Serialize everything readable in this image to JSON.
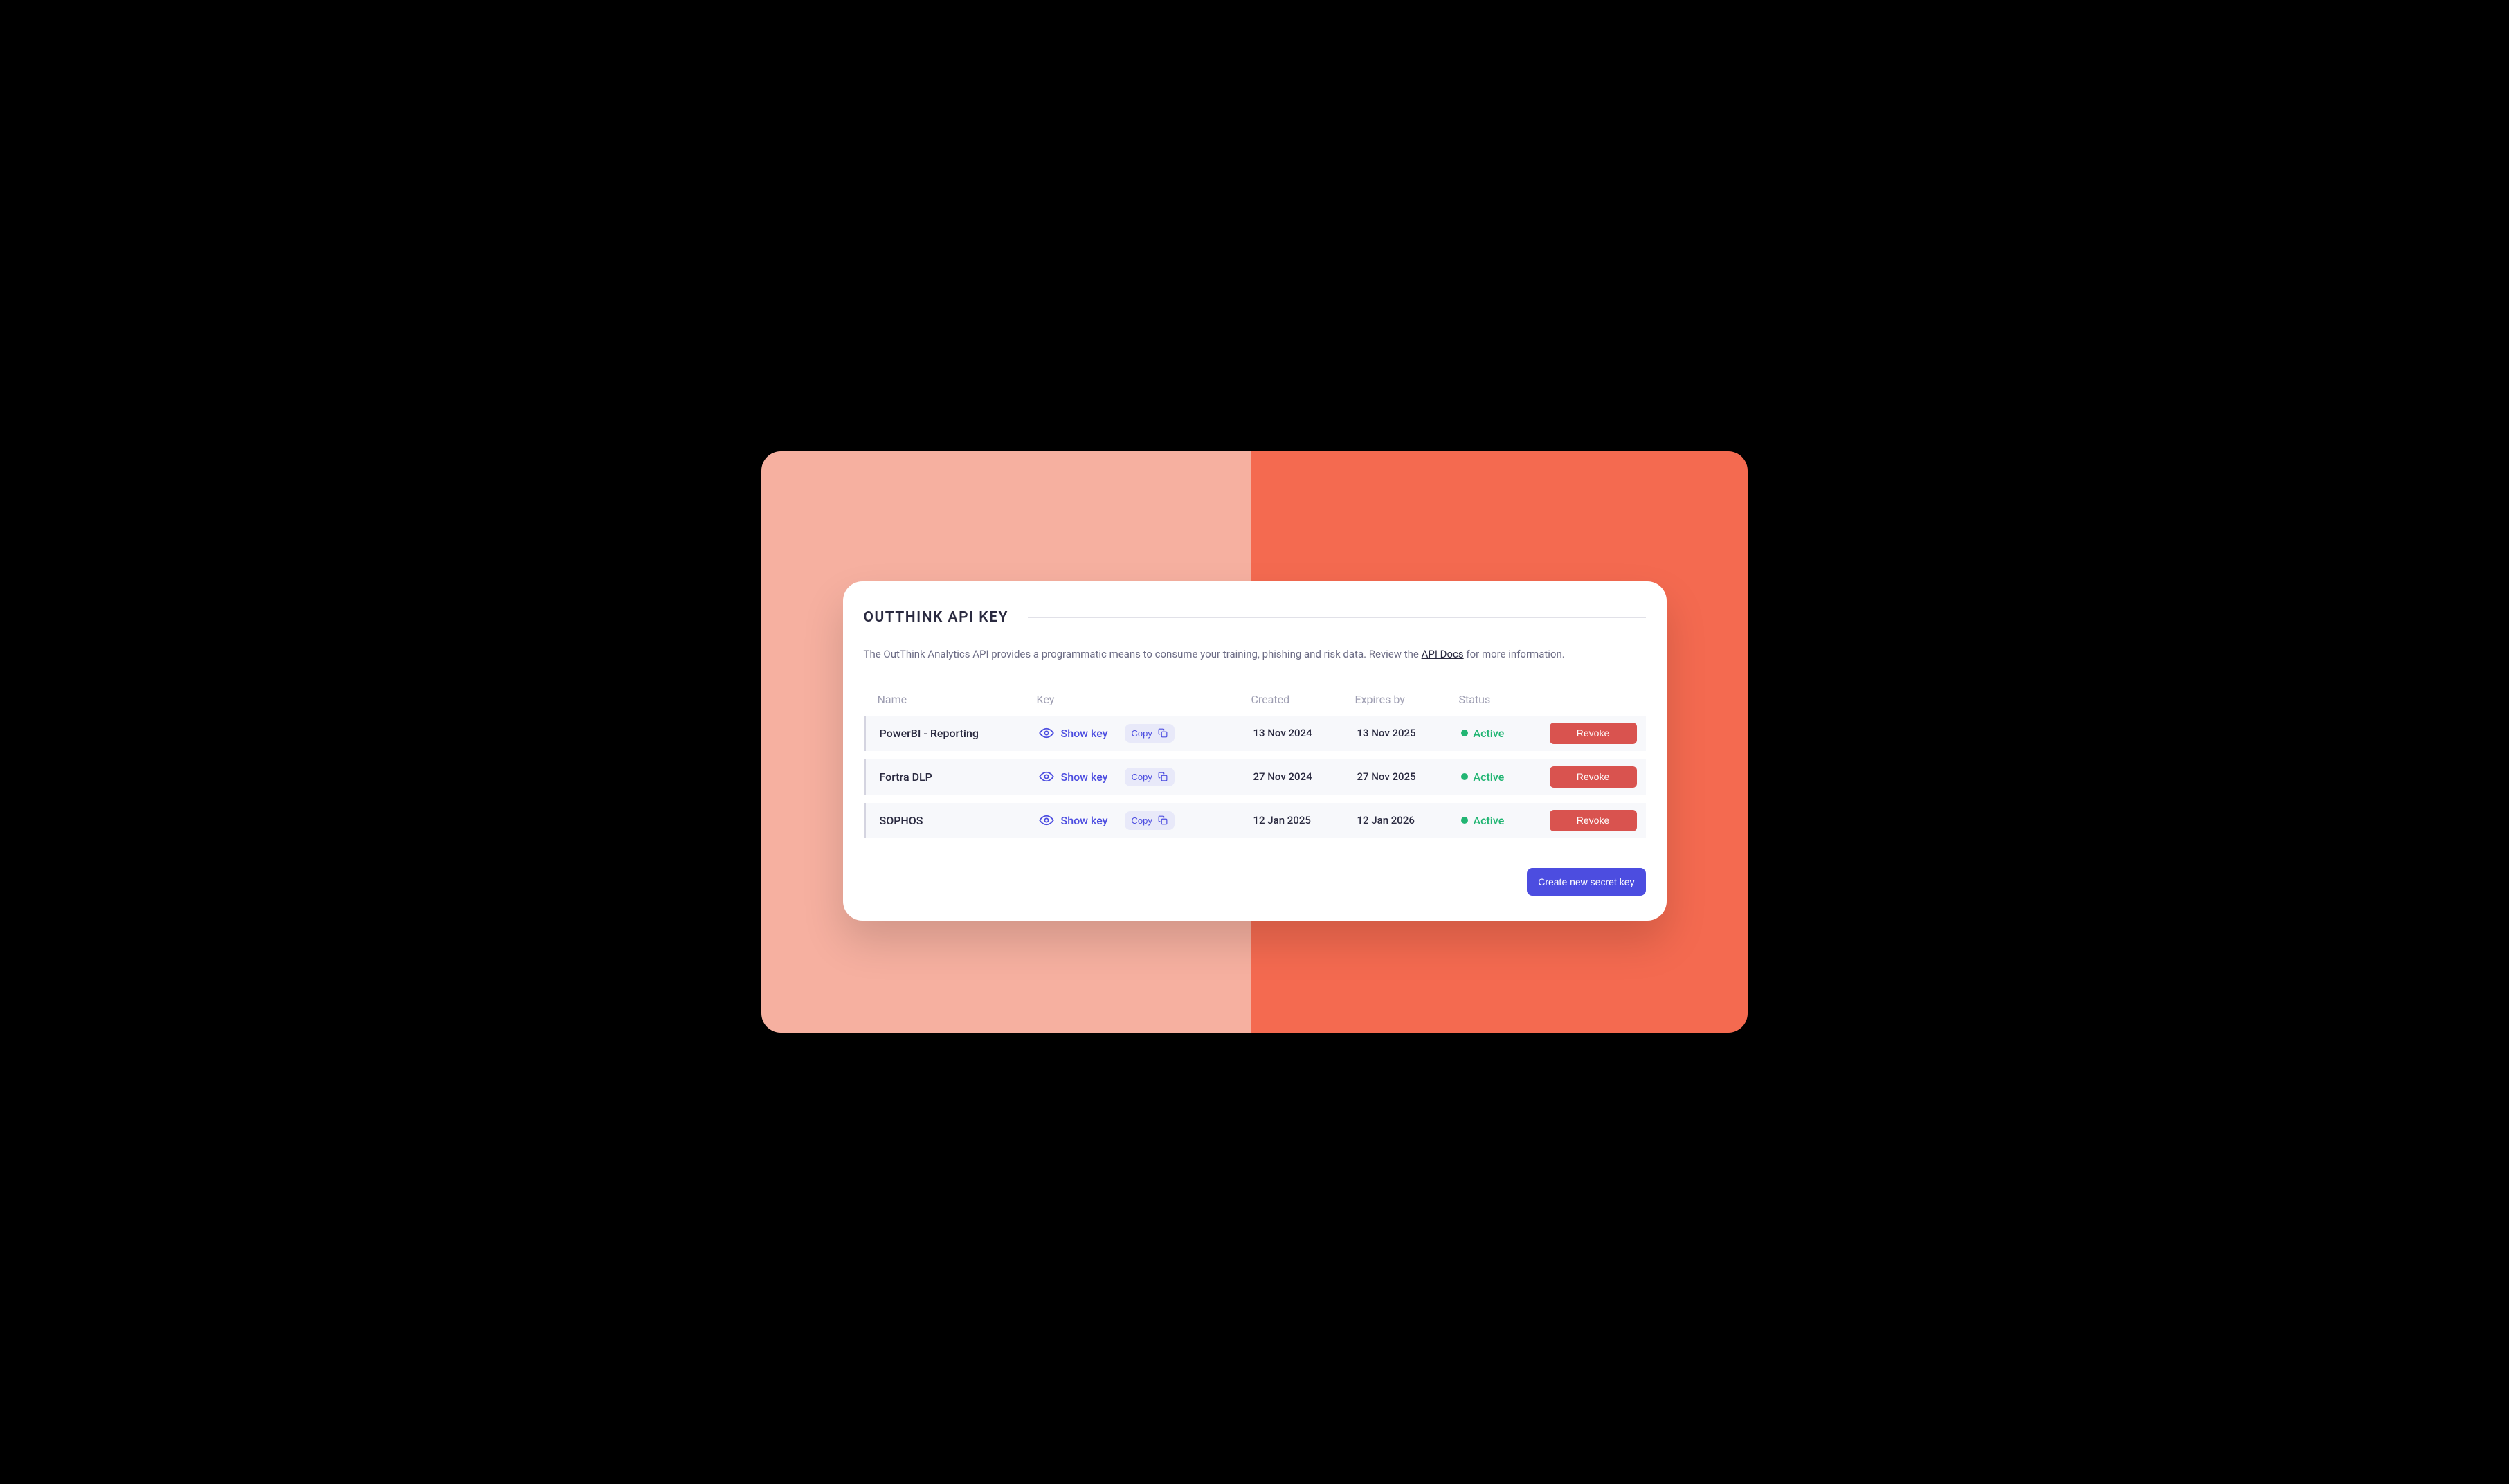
{
  "header": {
    "title": "OUTTHINK API KEY"
  },
  "description": {
    "pre": "The OutThink Analytics API provides a programmatic means to consume your training, phishing and risk data. Review the ",
    "link_text": "API Docs",
    "post": " for more information."
  },
  "table": {
    "columns": {
      "name": "Name",
      "key": "Key",
      "created": "Created",
      "expires": "Expires by",
      "status": "Status"
    },
    "actions": {
      "show_key": "Show key",
      "copy": "Copy",
      "revoke": "Revoke"
    },
    "rows": [
      {
        "name": "PowerBI - Reporting",
        "created": "13 Nov 2024",
        "expires": "13 Nov 2025",
        "status": "Active"
      },
      {
        "name": "Fortra DLP",
        "created": "27 Nov 2024",
        "expires": "27 Nov 2025",
        "status": "Active"
      },
      {
        "name": "SOPHOS",
        "created": "12 Jan 2025",
        "expires": "12 Jan 2026",
        "status": "Active"
      }
    ]
  },
  "footer": {
    "create_label": "Create new secret key"
  },
  "colors": {
    "accent_left": "#f6b0a0",
    "accent_right": "#f46a50",
    "primary": "#4c4de0",
    "danger": "#d9534f",
    "success": "#22b573"
  }
}
